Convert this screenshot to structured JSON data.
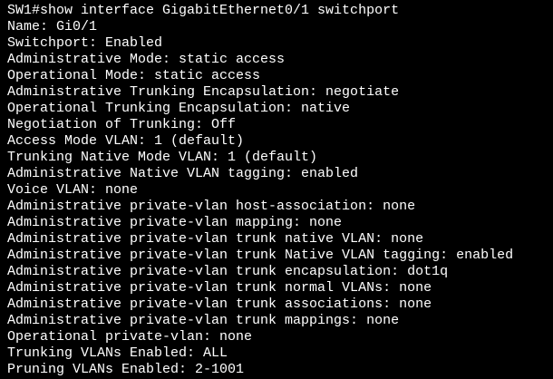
{
  "terminal": {
    "prompt_line": "SW1#show interface GigabitEthernet0/1 switchport",
    "lines": [
      "Name: Gi0/1",
      "Switchport: Enabled",
      "Administrative Mode: static access",
      "Operational Mode: static access",
      "Administrative Trunking Encapsulation: negotiate",
      "Operational Trunking Encapsulation: native",
      "Negotiation of Trunking: Off",
      "Access Mode VLAN: 1 (default)",
      "Trunking Native Mode VLAN: 1 (default)",
      "Administrative Native VLAN tagging: enabled",
      "Voice VLAN: none",
      "Administrative private-vlan host-association: none",
      "Administrative private-vlan mapping: none",
      "Administrative private-vlan trunk native VLAN: none",
      "Administrative private-vlan trunk Native VLAN tagging: enabled",
      "Administrative private-vlan trunk encapsulation: dot1q",
      "Administrative private-vlan trunk normal VLANs: none",
      "Administrative private-vlan trunk associations: none",
      "Administrative private-vlan trunk mappings: none",
      "Operational private-vlan: none",
      "Trunking VLANs Enabled: ALL",
      "Pruning VLANs Enabled: 2-1001"
    ],
    "colors": {
      "background": "#000000",
      "text": "#ffffff"
    }
  }
}
